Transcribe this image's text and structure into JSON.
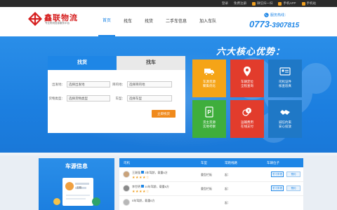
{
  "topbar": {
    "links": [
      {
        "label": "登录",
        "color": "#1e86e6"
      },
      {
        "label": "免费注册",
        "color": "#9b9b9b"
      },
      {
        "label": "微信扫一扫",
        "color": "#f0a020"
      },
      {
        "label": "手机APP",
        "color": "#f0a020"
      },
      {
        "label": "手机站",
        "color": "#f0a020"
      }
    ]
  },
  "logo": {
    "title": "鑫联物流",
    "subtitle": "专业物流信息服务平台"
  },
  "nav": {
    "items": [
      "首页",
      "找车",
      "找货",
      "二手车信息",
      "加入车队"
    ],
    "active_index": 0
  },
  "hotline": {
    "label": "服务热线：",
    "number_main": "0773",
    "number_rest": "-3907815"
  },
  "search": {
    "tabs": [
      "找货",
      "找车"
    ],
    "fields": {
      "origin_label": "出发地：",
      "origin_value": "选择出发地",
      "dest_label": "目的地：",
      "dest_value": "选择目的地",
      "goods_label": "货物类型：",
      "goods_value": "选择货物类型",
      "vehicle_label": "车型：",
      "vehicle_value": "选择车型"
    },
    "submit": "立即找货"
  },
  "advantages": {
    "title": "六大核心优势：",
    "cards": [
      {
        "line1": "车源货源",
        "line2": "聚集优化",
        "color": "#f5a417",
        "icon": "truck-icon"
      },
      {
        "line1": "车辆定位",
        "line2": "全程查询",
        "color": "#e23c2c",
        "icon": "location-pin-icon"
      },
      {
        "line1": "司机证件",
        "line2": "核查验真",
        "color": "#1f78c6",
        "icon": "id-card-icon"
      },
      {
        "line1": "货主货源",
        "line2": "实地考察",
        "color": "#3fae3c",
        "icon": "parking-icon"
      },
      {
        "line1": "运输费用",
        "line2": "在线支付",
        "color": "#e23c2c",
        "icon": "coins-icon"
      },
      {
        "line1": "诚信约束",
        "line2": "安心投放",
        "color": "#1f78c6",
        "icon": "handshake-icon"
      }
    ]
  },
  "vehicle_source": {
    "title": "车源信息",
    "illus_name": "王刚"
  },
  "table": {
    "headers": [
      "司机",
      "车型",
      "常跑线路",
      "车辆位子"
    ],
    "rows": [
      {
        "name": "王刚强",
        "desc": "3年驾龄，载重6方",
        "stars": "★★★★☆",
        "type": "重型栏板",
        "route": "起：",
        "status": "暂无数据",
        "action": "预约"
      },
      {
        "name": "李世明",
        "desc": "10年驾龄，载重6方",
        "stars": "★★★★☆",
        "type": "重型栏板",
        "route": "起：",
        "status": "暂无数据",
        "action": "预约"
      },
      {
        "name": "",
        "desc": "5年驾龄，载重6方",
        "stars": "",
        "type": "",
        "route": "起：",
        "status": "",
        "action": ""
      }
    ]
  }
}
